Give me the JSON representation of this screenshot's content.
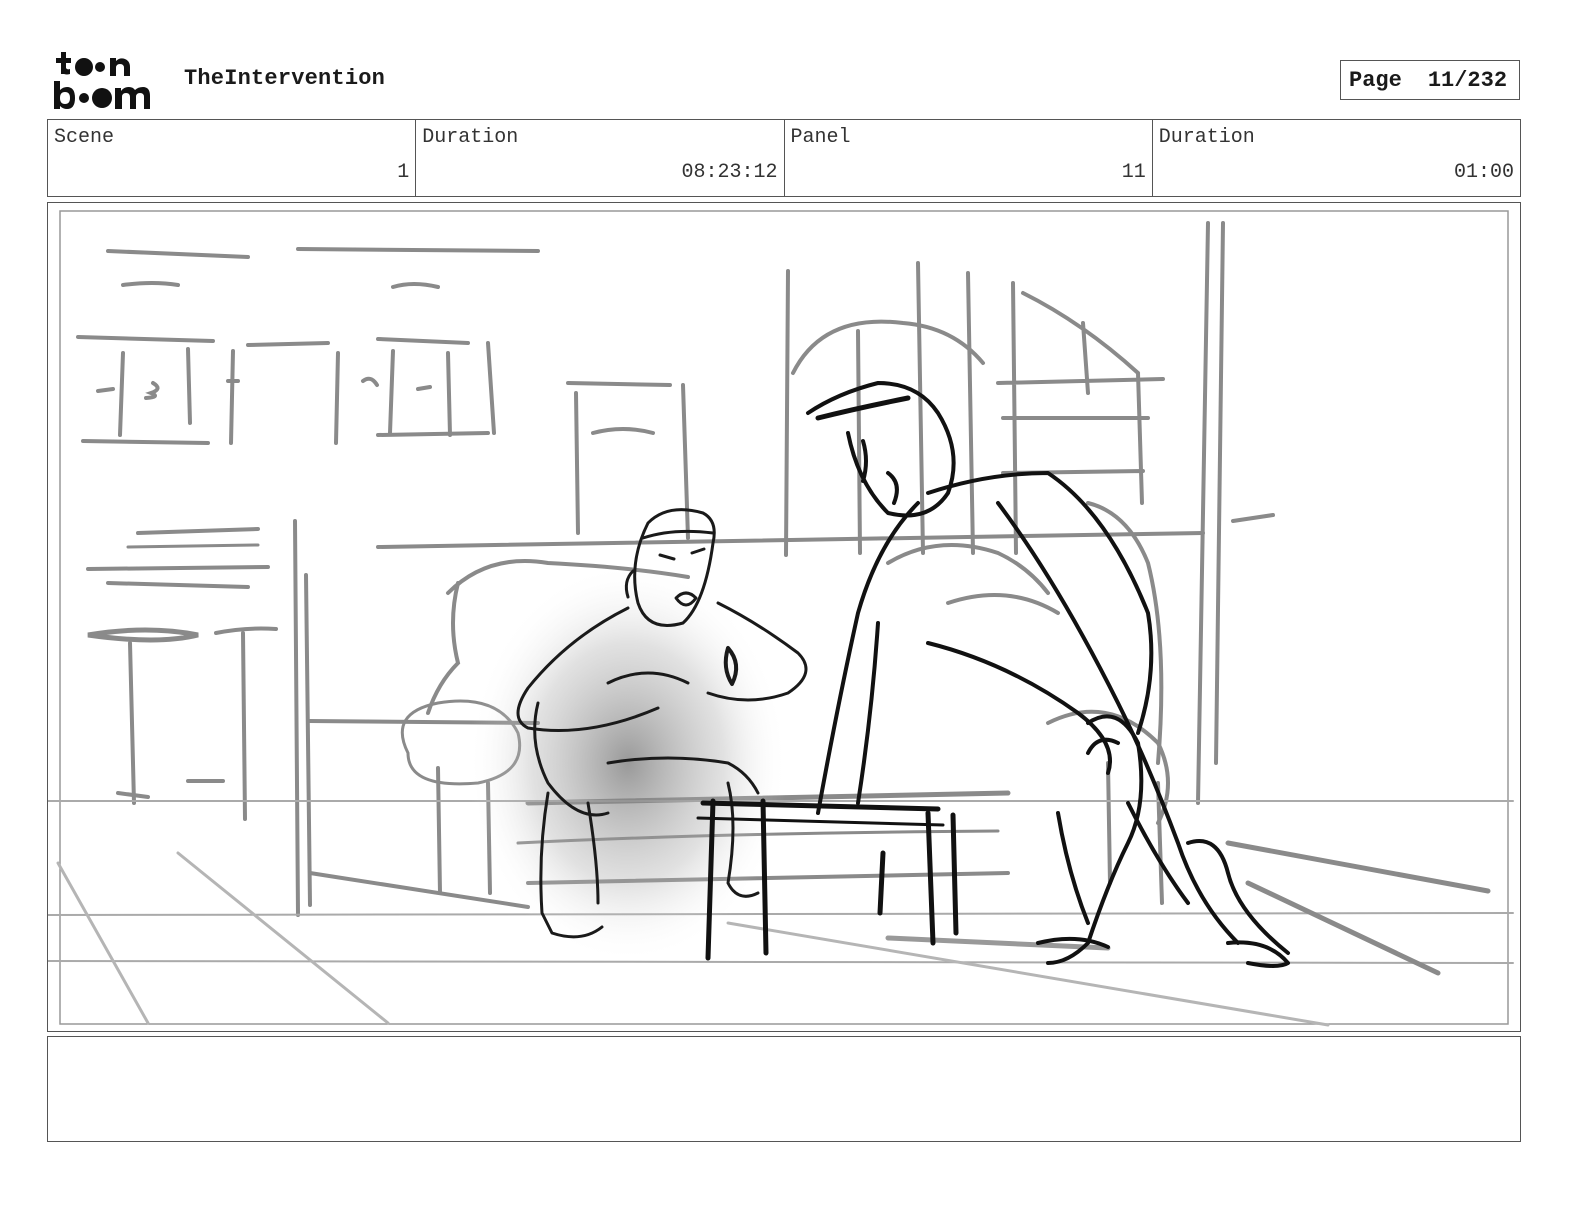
{
  "header": {
    "logo_text": "toonboom",
    "project_title": "TheIntervention",
    "page_label": "Page",
    "page_value": "11/232"
  },
  "info": {
    "scene_label": "Scene",
    "scene_value": "1",
    "scene_duration_label": "Duration",
    "scene_duration_value": "08:23:12",
    "panel_label": "Panel",
    "panel_value": "11",
    "panel_duration_label": "Duration",
    "panel_duration_value": "01:00"
  },
  "panel": {
    "image_name": "storyboard-sketch"
  },
  "notes": {
    "text": ""
  }
}
